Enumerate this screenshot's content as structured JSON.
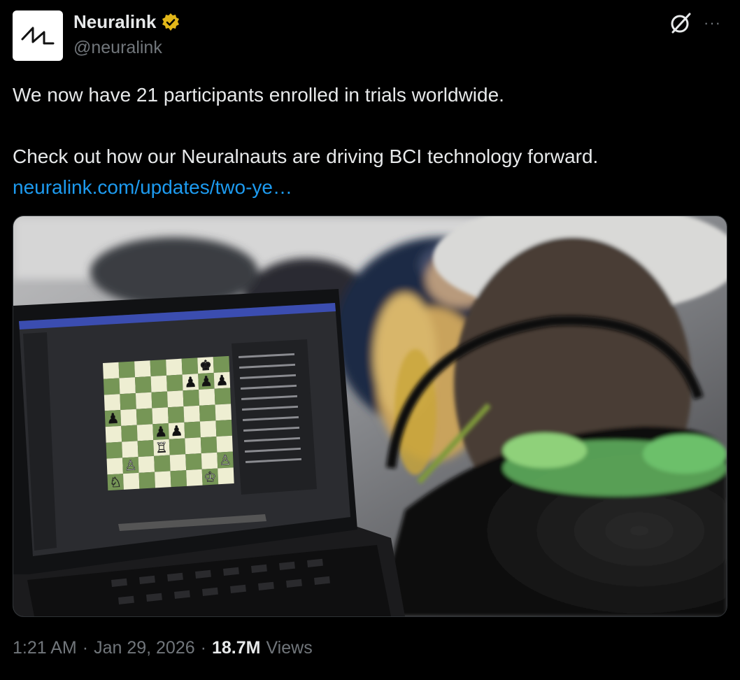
{
  "author": {
    "display_name": "Neuralink",
    "handle": "@neuralink",
    "verified": true,
    "verified_badge_color": "#e2b719"
  },
  "actions": {
    "grok_icon": "grok-icon",
    "more_label": "···"
  },
  "tweet": {
    "line1": "We now have 21 participants enrolled in trials worldwide.",
    "line2": "Check out how our Neuralnauts are driving BCI technology forward.",
    "link": "neuralink.com/updates/two-ye…"
  },
  "media": {
    "description_icon": "photo"
  },
  "meta": {
    "time": "1:21 AM",
    "sep1": "·",
    "date": "Jan 29, 2026",
    "sep2": "·",
    "views_count": "18.7M",
    "views_label": "Views"
  },
  "colors": {
    "background": "#000000",
    "text": "#e7e9ea",
    "secondary": "#71767b",
    "link": "#1d9bf0",
    "chess_light": "#eeeed2",
    "chess_dark": "#769656"
  }
}
